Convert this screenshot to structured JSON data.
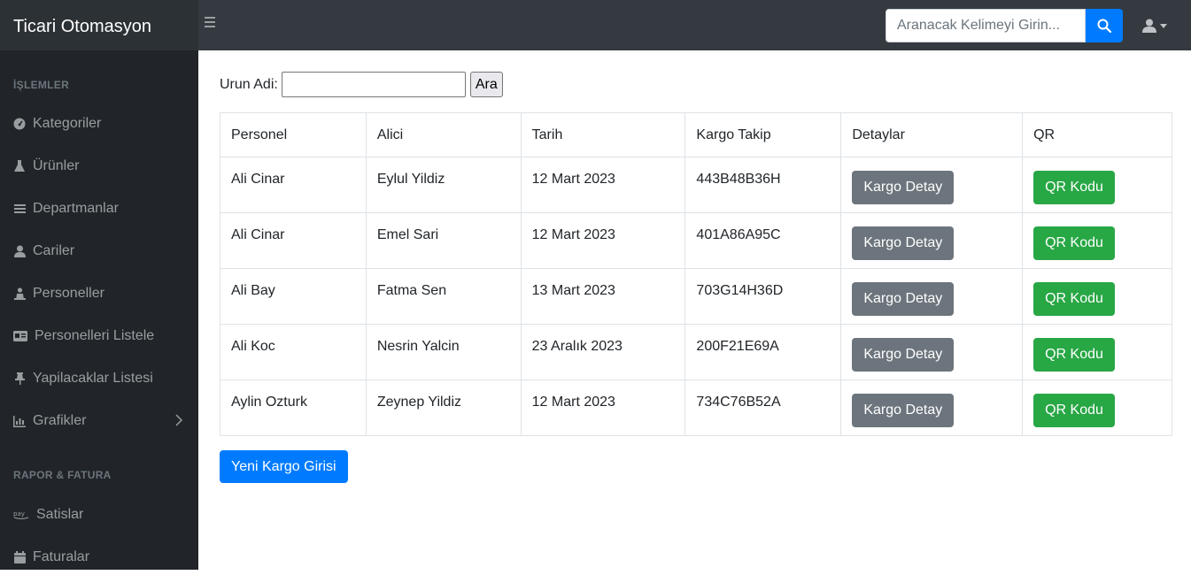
{
  "topbar": {
    "brand": "Ticari Otomasyon",
    "search_placeholder": "Aranacak Kelimeyi Girin..."
  },
  "sidebar": {
    "section1": "İŞLEMLER",
    "items": [
      {
        "label": "Kategoriler",
        "icon": "tachometer-icon"
      },
      {
        "label": "Ürünler",
        "icon": "flask-icon"
      },
      {
        "label": "Departmanlar",
        "icon": "list-icon"
      },
      {
        "label": "Cariler",
        "icon": "user-icon"
      },
      {
        "label": "Personeller",
        "icon": "person-icon"
      },
      {
        "label": "Personelleri Listele",
        "icon": "id-card-icon"
      },
      {
        "label": "Yapilacaklar Listesi",
        "icon": "thumbtack-icon"
      },
      {
        "label": "Grafikler",
        "icon": "chart-icon"
      }
    ],
    "section2": "RAPOR & FATURA",
    "items2": [
      {
        "label": "Satislar",
        "icon": "pay-icon"
      },
      {
        "label": "Faturalar",
        "icon": "calendar-icon"
      }
    ]
  },
  "filter": {
    "label": "Urun Adi:",
    "value": "",
    "button": "Ara"
  },
  "table": {
    "headers": [
      "Personel",
      "Alici",
      "Tarih",
      "Kargo Takip",
      "Detaylar",
      "QR"
    ],
    "rows": [
      {
        "personel": "Ali Cinar",
        "alici": "Eylul Yildiz",
        "tarih": "12 Mart 2023",
        "takip": "443B48B36H",
        "detay": "Kargo Detay",
        "qr": "QR Kodu"
      },
      {
        "personel": "Ali Cinar",
        "alici": "Emel Sari",
        "tarih": "12 Mart 2023",
        "takip": "401A86A95C",
        "detay": "Kargo Detay",
        "qr": "QR Kodu"
      },
      {
        "personel": "Ali Bay",
        "alici": "Fatma Sen",
        "tarih": "13 Mart 2023",
        "takip": "703G14H36D",
        "detay": "Kargo Detay",
        "qr": "QR Kodu"
      },
      {
        "personel": "Ali Koc",
        "alici": "Nesrin Yalcin",
        "tarih": "23 Aralık 2023",
        "takip": "200F21E69A",
        "detay": "Kargo Detay",
        "qr": "QR Kodu"
      },
      {
        "personel": "Aylin Ozturk",
        "alici": "Zeynep Yildiz",
        "tarih": "12 Mart 2023",
        "takip": "734C76B52A",
        "detay": "Kargo Detay",
        "qr": "QR Kodu"
      }
    ]
  },
  "new_button": "Yeni Kargo Girisi",
  "colors": {
    "primary": "#007bff",
    "success": "#28a745",
    "secondary": "#6c757d",
    "sidebar_bg": "#212529",
    "topbar_bg": "#343a40"
  }
}
